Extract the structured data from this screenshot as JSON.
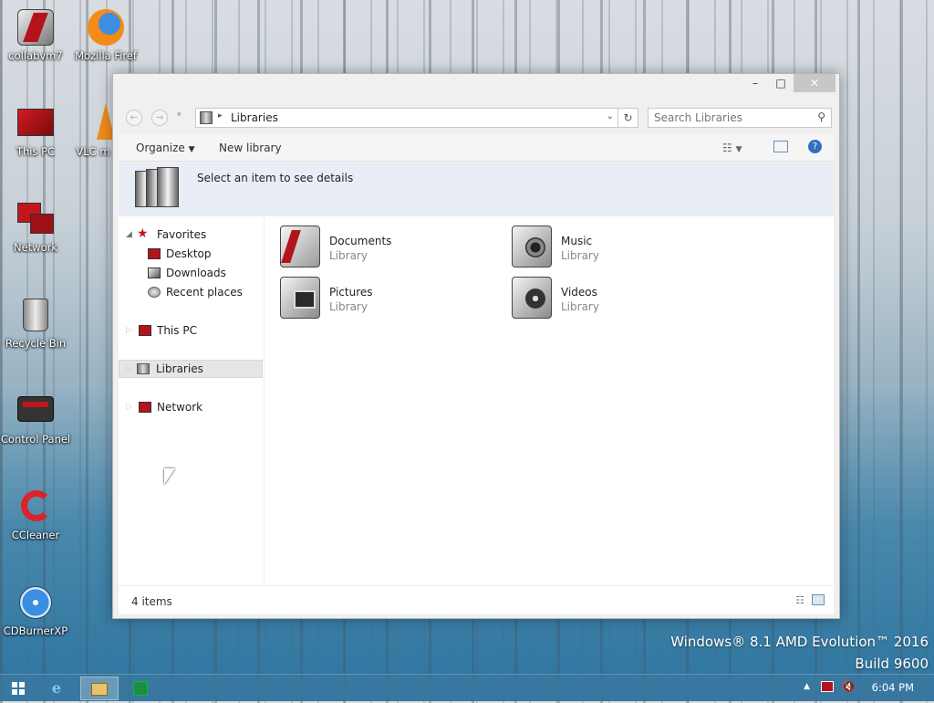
{
  "desktop": {
    "icons": [
      {
        "label": "collabvm7"
      },
      {
        "label": "Mozilla Firef"
      },
      {
        "label": "This PC"
      },
      {
        "label": "VLC m play"
      },
      {
        "label": "Network"
      },
      {
        "label": "Recycle Bin"
      },
      {
        "label": "Control Panel"
      },
      {
        "label": "CCleaner"
      },
      {
        "label": "CDBurnerXP"
      }
    ],
    "watermark_line1": "Windows® 8.1 AMD Evolution™ 2016",
    "watermark_line2": "Build 9600"
  },
  "window": {
    "minimize": "–",
    "maximize": "□",
    "close": "✕",
    "back": "←",
    "forward": "→",
    "address": "Libraries",
    "search_placeholder": "Search Libraries",
    "toolbar": {
      "organize": "Organize",
      "new_library": "New library"
    },
    "details_text": "Select an item to see details",
    "nav": {
      "favorites": "Favorites",
      "desktop": "Desktop",
      "downloads": "Downloads",
      "recent": "Recent places",
      "this_pc": "This PC",
      "libraries": "Libraries",
      "network": "Network"
    },
    "libraries": [
      {
        "name": "Documents",
        "type": "Library"
      },
      {
        "name": "Music",
        "type": "Library"
      },
      {
        "name": "Pictures",
        "type": "Library"
      },
      {
        "name": "Videos",
        "type": "Library"
      }
    ],
    "status": "4 items"
  },
  "taskbar": {
    "time": "6:04 PM"
  },
  "colors": {
    "accent_red": "#b3141b",
    "taskbar": "#3d7aa2"
  }
}
